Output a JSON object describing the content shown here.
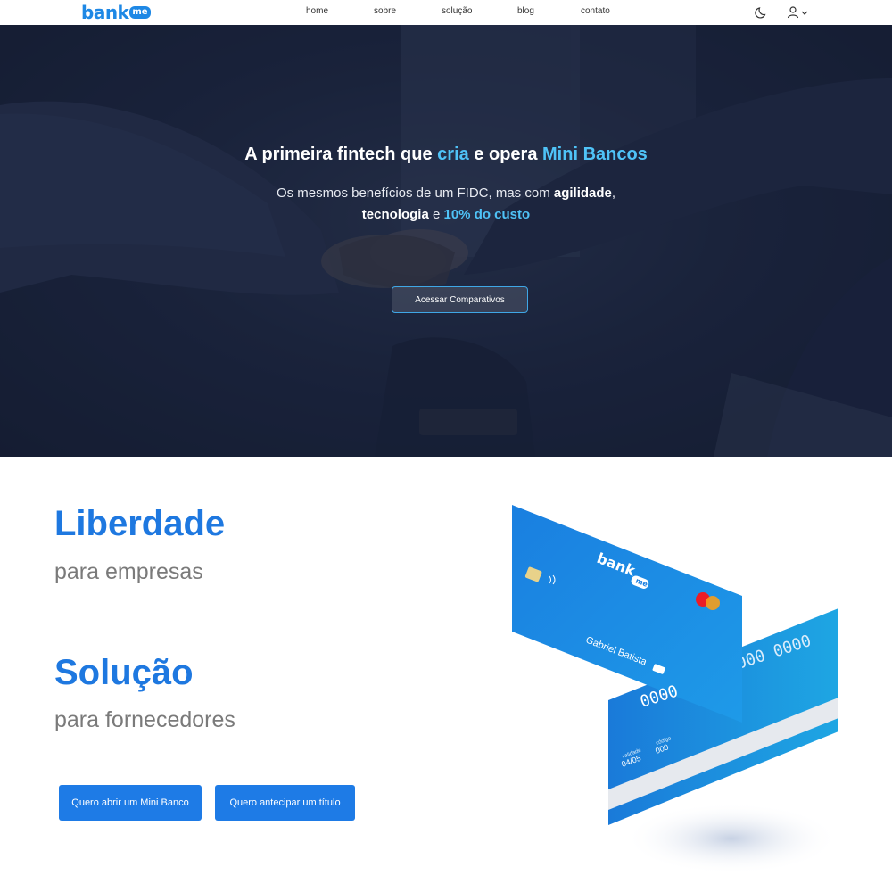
{
  "brand": {
    "name": "bank",
    "badge": "me"
  },
  "nav": {
    "links": [
      "home",
      "sobre",
      "solução",
      "blog",
      "contato"
    ],
    "theme_icon": "moon-icon",
    "user_icon": "user-icon",
    "dropdown_icon": "chevron-down-icon"
  },
  "hero": {
    "title_part1": "A primeira fintech que ",
    "title_hl1": "cria",
    "title_part2": " e opera ",
    "title_hl2": "Mini Bancos",
    "sub_part1": "Os mesmos benefícios de um FIDC, mas com ",
    "sub_bold1": "agilidade",
    "sub_part2": ",",
    "sub_bold2": "tecnologia",
    "sub_part3": " e ",
    "sub_hl": "10% do custo",
    "button": "Acessar Comparativos"
  },
  "features": {
    "title1": "Liberdade",
    "sub1": "para empresas",
    "title2": "Solução",
    "sub2": "para fornecedores",
    "cta1": "Quero abrir um Mini Banco",
    "cta2": "Quero antecipar um título"
  },
  "card": {
    "brand": "bank",
    "badge": "me",
    "holder": "Gabriel Batista",
    "number_front": "0000",
    "number_back": "000 0000",
    "validade_label": "validade",
    "validade": "04/05",
    "codigo_label": "código",
    "codigo": "000"
  },
  "colors": {
    "accent": "#1e78e0",
    "highlight": "#4fc3f7",
    "hero_bg": "#1f2842"
  }
}
